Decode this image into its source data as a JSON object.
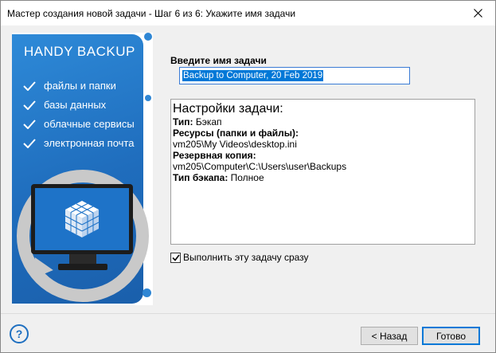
{
  "window": {
    "title": "Мастер создания новой задачи - Шаг 6 из 6: Укажите имя задачи"
  },
  "banner": {
    "brand": "HANDY BACKUP",
    "features": [
      "файлы и папки",
      "базы данных",
      "облачные сервисы",
      "электронная почта"
    ],
    "accent_color": "#1f6dbd"
  },
  "form": {
    "name_label": "Введите имя задачи",
    "name_value": "Backup to Computer, 20 Feb 2019"
  },
  "summary": {
    "header": "Настройки задачи:",
    "type_label": "Тип:",
    "type_value": " Бэкап",
    "resources_label": "Ресурсы (папки и файлы):",
    "resources_value": "vm205\\My Videos\\desktop.ini",
    "backup_label": "Резервная копия:",
    "backup_value": "vm205\\Computer\\C:\\Users\\user\\Backups",
    "backup_type_label": "Тип бэкапа:",
    "backup_type_value": " Полное"
  },
  "run_now": {
    "label": "Выполнить эту задачу сразу",
    "checked": true
  },
  "buttons": {
    "help": "?",
    "back": "< Назад",
    "finish": "Готово"
  }
}
